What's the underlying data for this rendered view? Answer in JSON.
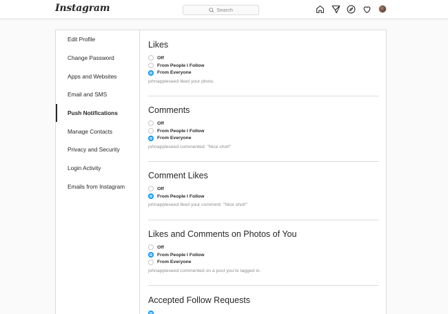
{
  "header": {
    "logo": "Instagram",
    "search_placeholder": "Search",
    "icons": [
      "home-icon",
      "direct-message-icon",
      "explore-icon",
      "activity-heart-icon",
      "profile-avatar"
    ]
  },
  "sidebar": {
    "items": [
      {
        "label": "Edit Profile",
        "active": false
      },
      {
        "label": "Change Password",
        "active": false
      },
      {
        "label": "Apps and Websites",
        "active": false
      },
      {
        "label": "Email and SMS",
        "active": false
      },
      {
        "label": "Push Notifications",
        "active": true
      },
      {
        "label": "Manage Contacts",
        "active": false
      },
      {
        "label": "Privacy and Security",
        "active": false
      },
      {
        "label": "Login Activity",
        "active": false
      },
      {
        "label": "Emails from Instagram",
        "active": false
      }
    ]
  },
  "sections": [
    {
      "title": "Likes",
      "options": [
        {
          "label": "Off",
          "checked": false
        },
        {
          "label": "From People I Follow",
          "checked": false
        },
        {
          "label": "From Everyone",
          "checked": true
        }
      ],
      "example": "johnappleseed liked your photo."
    },
    {
      "title": "Comments",
      "options": [
        {
          "label": "Off",
          "checked": false
        },
        {
          "label": "From People I Follow",
          "checked": false
        },
        {
          "label": "From Everyone",
          "checked": true
        }
      ],
      "example": "johnappleseed commented: \"Nice shot!\""
    },
    {
      "title": "Comment Likes",
      "options": [
        {
          "label": "Off",
          "checked": false
        },
        {
          "label": "From People I Follow",
          "checked": true
        }
      ],
      "example": "johnappleseed liked your comment: \"Nice shot!\""
    },
    {
      "title": "Likes and Comments on Photos of You",
      "options": [
        {
          "label": "Off",
          "checked": false
        },
        {
          "label": "From People I Follow",
          "checked": true
        },
        {
          "label": "From Everyone",
          "checked": false
        }
      ],
      "example": "johnappleseed commented on a post you're tagged in."
    },
    {
      "title": "Accepted Follow Requests",
      "options": [],
      "example": ""
    }
  ],
  "colors": {
    "accent": "#0095f6",
    "border": "#dbdbdb",
    "muted_text": "#8e8e8e",
    "background": "#fafafa"
  }
}
